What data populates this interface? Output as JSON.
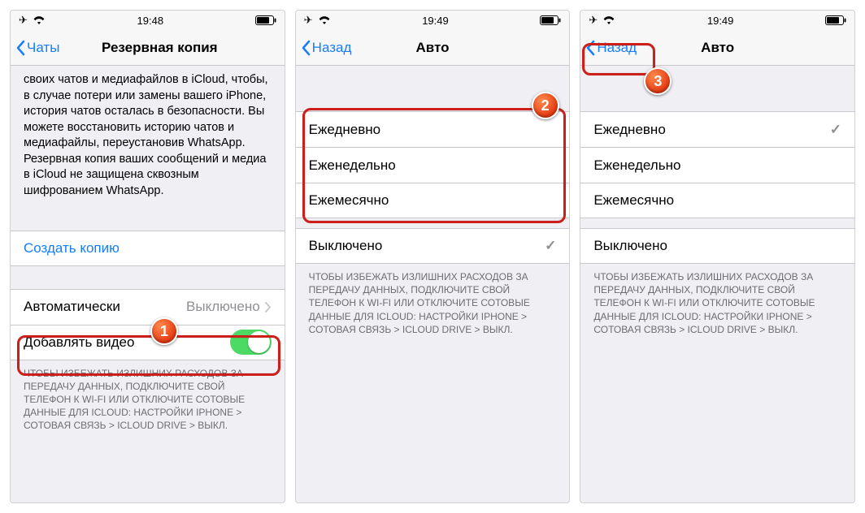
{
  "status": {
    "time1": "19:48",
    "time2": "19:49",
    "time3": "19:49"
  },
  "screen1": {
    "back": "Чаты",
    "title": "Резервная копия",
    "intro": "своих чатов и медиафайлов в iCloud, чтобы, в случае потери или замены вашего iPhone, история чатов осталась в безопасности. Вы можете восстановить историю чатов и медиафайлы, переустановив WhatsApp. Резервная копия ваших сообщений и медиа в iCloud не защищена сквозным шифрованием WhatsApp.",
    "createBackup": "Создать копию",
    "autoLabel": "Автоматически",
    "autoValue": "Выключено",
    "includeVideo": "Добавлять видео",
    "footer": "Чтобы избежать излишних расходов за передачу данных, подключите свой телефон к Wi-Fi или отключите сотовые данные для iCloud: Настройки iPhone > Сотовая Связь > iCloud Drive > Выкл."
  },
  "screen2": {
    "back": "Назад",
    "title": "Авто",
    "opt1": "Ежедневно",
    "opt2": "Еженедельно",
    "opt3": "Ежемесячно",
    "opt4": "Выключено",
    "footer": "Чтобы избежать излишних расходов за передачу данных, подключите свой телефон к Wi-Fi или отключите сотовые данные для iCloud: Настройки iPhone > Сотовая Связь > iCloud Drive > Выкл."
  },
  "screen3": {
    "back": "Назад",
    "title": "Авто",
    "opt1": "Ежедневно",
    "opt2": "Еженедельно",
    "opt3": "Ежемесячно",
    "opt4": "Выключено",
    "footer": "Чтобы избежать излишних расходов за передачу данных, подключите свой телефон к Wi-Fi или отключите сотовые данные для iCloud: Настройки iPhone > Сотовая Связь > iCloud Drive > Выкл."
  },
  "badges": {
    "b1": "1",
    "b2": "2",
    "b3": "3"
  }
}
